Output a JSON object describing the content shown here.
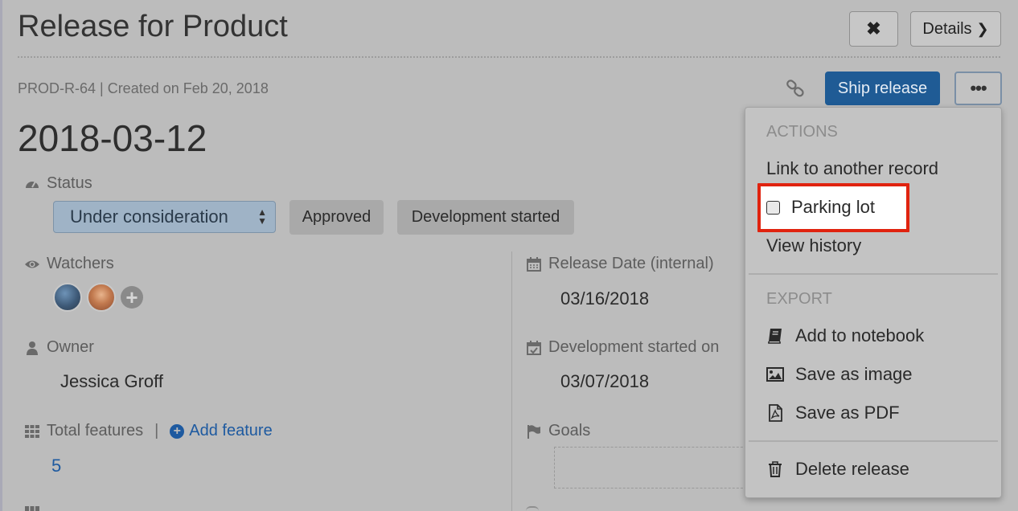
{
  "window": {
    "title": "Release for Product",
    "close_label": "✖",
    "details_label": "Details",
    "details_chevron": "❯"
  },
  "record": {
    "id_meta": "PROD-R-64 | Created on Feb 20, 2018",
    "ship_label": "Ship release",
    "more_label": "•••",
    "name": "2018-03-12"
  },
  "fields": {
    "status": {
      "label": "Status",
      "value": "Under consideration",
      "options": [
        "Approved",
        "Development started"
      ]
    },
    "watchers": {
      "label": "Watchers",
      "add_label": "+"
    },
    "owner": {
      "label": "Owner",
      "value": "Jessica Groff"
    },
    "total_features": {
      "label": "Total features",
      "separator": "|",
      "add_label": "Add feature",
      "count": "5"
    },
    "release_date": {
      "label": "Release Date (internal)",
      "value": "03/16/2018"
    },
    "development_started": {
      "label": "Development started on",
      "value": "03/07/2018"
    },
    "goals": {
      "label": "Goals"
    }
  },
  "dropdown": {
    "actions_header": "ACTIONS",
    "link_record": "Link to another record",
    "parking_lot": "Parking lot",
    "view_history": "View history",
    "export_header": "EXPORT",
    "add_notebook": "Add to notebook",
    "save_image": "Save as image",
    "save_pdf": "Save as PDF",
    "delete_release": "Delete release"
  },
  "colors": {
    "primary": "#1f5b95",
    "link": "#1e5aa0",
    "highlight": "#e0230f"
  },
  "icons": [
    "close-icon",
    "chevron-right-icon",
    "link-icon",
    "ellipsis-icon",
    "dashboard-icon",
    "eye-icon",
    "user-icon",
    "grid-icon",
    "plus-circle-icon",
    "calendar-icon",
    "calendar-check-icon",
    "flag-icon",
    "book-icon",
    "image-icon",
    "pdf-file-icon",
    "trash-icon"
  ]
}
